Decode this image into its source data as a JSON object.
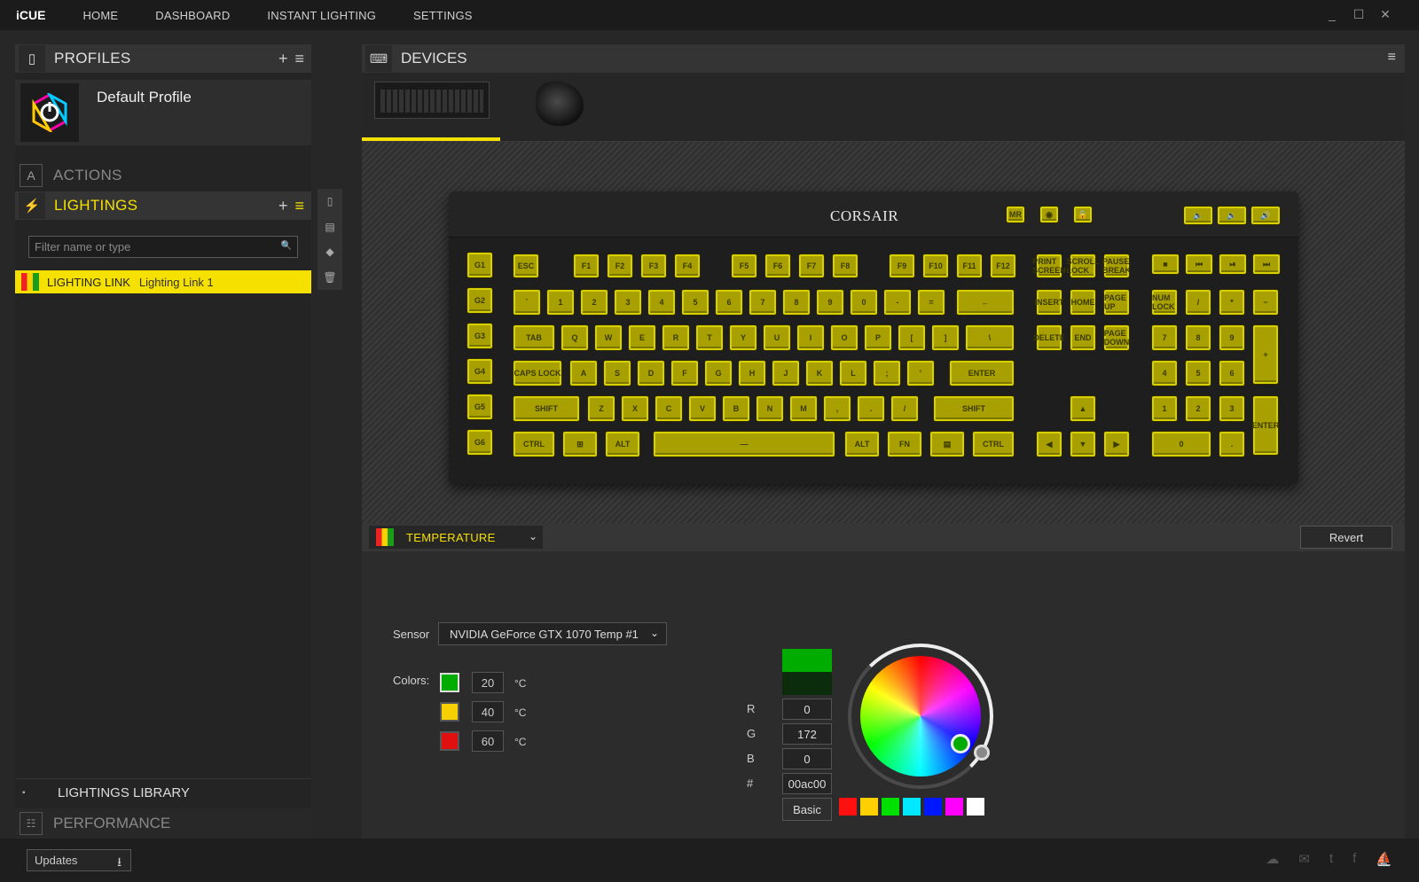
{
  "app": {
    "brand": "iCUE"
  },
  "nav": [
    "HOME",
    "DASHBOARD",
    "INSTANT LIGHTING",
    "SETTINGS"
  ],
  "window_controls": [
    "_",
    "☐",
    "✕"
  ],
  "profiles": {
    "title": "PROFILES",
    "default_profile": "Default Profile"
  },
  "actions": {
    "title": "ACTIONS"
  },
  "lightings": {
    "title": "LIGHTINGS",
    "filter_placeholder": "Filter name or type",
    "selected_item": {
      "type": "LIGHTING LINK",
      "name": "Lighting Link 1"
    }
  },
  "library": {
    "title": "LIGHTINGS LIBRARY"
  },
  "performance": {
    "title": "PERFORMANCE"
  },
  "devices": {
    "title": "DEVICES"
  },
  "keyboard": {
    "brand": "CORSAIR",
    "gkeys": [
      "G1",
      "G2",
      "G3",
      "G4",
      "G5",
      "G6"
    ],
    "row_fn": [
      "ESC",
      "F1",
      "F2",
      "F3",
      "F4",
      "F5",
      "F6",
      "F7",
      "F8",
      "F9",
      "F10",
      "F11",
      "F12"
    ],
    "row_num": [
      "`",
      "1",
      "2",
      "3",
      "4",
      "5",
      "6",
      "7",
      "8",
      "9",
      "0",
      "-",
      "=",
      "←"
    ],
    "row_q": [
      "TAB",
      "Q",
      "W",
      "E",
      "R",
      "T",
      "Y",
      "U",
      "I",
      "O",
      "P",
      "[",
      "]",
      "\\"
    ],
    "row_a": [
      "CAPS LOCK",
      "A",
      "S",
      "D",
      "F",
      "G",
      "H",
      "J",
      "K",
      "L",
      ";",
      "'",
      "ENTER"
    ],
    "row_z": [
      "SHIFT",
      "Z",
      "X",
      "C",
      "V",
      "B",
      "N",
      "M",
      ",",
      ".",
      "/",
      "SHIFT"
    ],
    "row_ctrl": [
      "CTRL",
      "⊞",
      "ALT",
      "—",
      "ALT",
      "FN",
      "▤",
      "CTRL"
    ],
    "nav_top": [
      "PRINT SCREEN",
      "SCROLL LOCK",
      "PAUSE BREAK"
    ],
    "nav_mid": [
      "INSERT",
      "HOME",
      "PAGE UP"
    ],
    "nav_low": [
      "DELETE",
      "END",
      "PAGE DOWN"
    ],
    "arrows": [
      "▲",
      "◀",
      "▼",
      "▶"
    ],
    "media": [
      "■",
      "⏮",
      "⏯",
      "⏭"
    ],
    "numpad_row1": [
      "NUM LOCK",
      "/",
      "*",
      "−"
    ],
    "numpad_row2": [
      "7",
      "8",
      "9",
      "+"
    ],
    "numpad_row3": [
      "4",
      "5",
      "6"
    ],
    "numpad_row4": [
      "1",
      "2",
      "3",
      "ENTER"
    ],
    "numpad_row5": [
      "0",
      "."
    ],
    "top_buttons": [
      "MR",
      "◉",
      "🔒"
    ],
    "volume": [
      "🔈",
      "🔉",
      "🔊"
    ]
  },
  "effect": {
    "name": "TEMPERATURE",
    "revert_label": "Revert"
  },
  "sensor": {
    "label": "Sensor",
    "value": "NVIDIA GeForce GTX 1070 Temp #1"
  },
  "colors": {
    "label": "Colors:",
    "unit": "°C",
    "stops": [
      {
        "color": "#00ac00",
        "temp": "20"
      },
      {
        "color": "#f6d000",
        "temp": "40"
      },
      {
        "color": "#e01010",
        "temp": "60"
      }
    ]
  },
  "rgb": {
    "r_label": "R",
    "g_label": "G",
    "b_label": "B",
    "hex_label": "#",
    "r": "0",
    "g": "172",
    "b": "0",
    "hex": "00ac00"
  },
  "basic_label": "Basic",
  "swatches": [
    "#ff1010",
    "#ffd000",
    "#00e000",
    "#00e8ff",
    "#0018ff",
    "#ff00ff",
    "#ffffff"
  ],
  "footer": {
    "updates_label": "Updates"
  },
  "accent": "#f6e000"
}
